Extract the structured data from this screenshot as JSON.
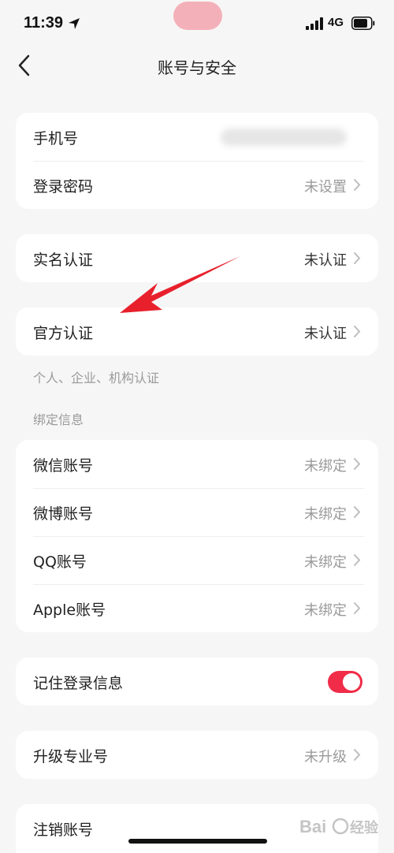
{
  "status_bar": {
    "time": "11:39",
    "network": "4G"
  },
  "nav": {
    "title": "账号与安全"
  },
  "account": {
    "phone_label": "手机号",
    "password_label": "登录密码",
    "password_value": "未设置"
  },
  "real_name": {
    "label": "实名认证",
    "value": "未认证"
  },
  "official": {
    "label": "官方认证",
    "value": "未认证",
    "hint": "个人、企业、机构认证"
  },
  "binding": {
    "section_title": "绑定信息",
    "items": [
      {
        "label": "微信账号",
        "value": "未绑定"
      },
      {
        "label": "微博账号",
        "value": "未绑定"
      },
      {
        "label": "QQ账号",
        "value": "未绑定"
      },
      {
        "label": "Apple账号",
        "value": "未绑定"
      }
    ]
  },
  "remember": {
    "label": "记住登录信息",
    "enabled": true
  },
  "upgrade": {
    "label": "升级专业号",
    "value": "未升级"
  },
  "cancel": {
    "label": "注销账号"
  },
  "colors": {
    "accent": "#f02c48",
    "arrow": "#e8202c",
    "background": "#f6f6f6"
  }
}
